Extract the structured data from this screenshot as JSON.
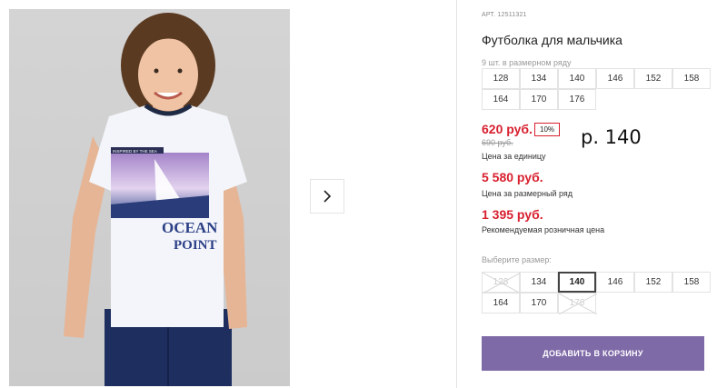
{
  "product": {
    "sku": "АРТ. 12511321",
    "title": "Футболка для мальчика",
    "row_info": "9 шт. в размерном ряду"
  },
  "size_range": [
    "128",
    "134",
    "140",
    "146",
    "152",
    "158",
    "164",
    "170",
    "176"
  ],
  "prices": {
    "unit_price": "620 руб.",
    "discount": "10%",
    "old_price": "690 руб.",
    "unit_caption": "Цена за единицу",
    "range_price": "5 580 руб.",
    "range_caption": "Цена за размерный ряд",
    "retail_price": "1 395 руб.",
    "retail_caption": "Рекомендуемая розничная цена"
  },
  "handwritten_note": "р. 140",
  "size_picker": {
    "label": "Выберите размер:",
    "options": [
      {
        "label": "128",
        "state": "unavailable"
      },
      {
        "label": "134",
        "state": "available"
      },
      {
        "label": "140",
        "state": "selected"
      },
      {
        "label": "146",
        "state": "available"
      },
      {
        "label": "152",
        "state": "available"
      },
      {
        "label": "158",
        "state": "available"
      },
      {
        "label": "164",
        "state": "available"
      },
      {
        "label": "170",
        "state": "available"
      },
      {
        "label": "176",
        "state": "unavailable"
      }
    ]
  },
  "cart_button": "ДОБАВИТЬ В КОРЗИНУ",
  "photo": {
    "shirt_print_small": "INSPIRED BY THE SEA",
    "shirt_print_big_1": "OCEAN",
    "shirt_print_big_2": "POINT"
  },
  "icons": {
    "next": "chevron-right-icon"
  },
  "colors": {
    "accent": "#7f6aa8",
    "price": "#d8202f"
  }
}
